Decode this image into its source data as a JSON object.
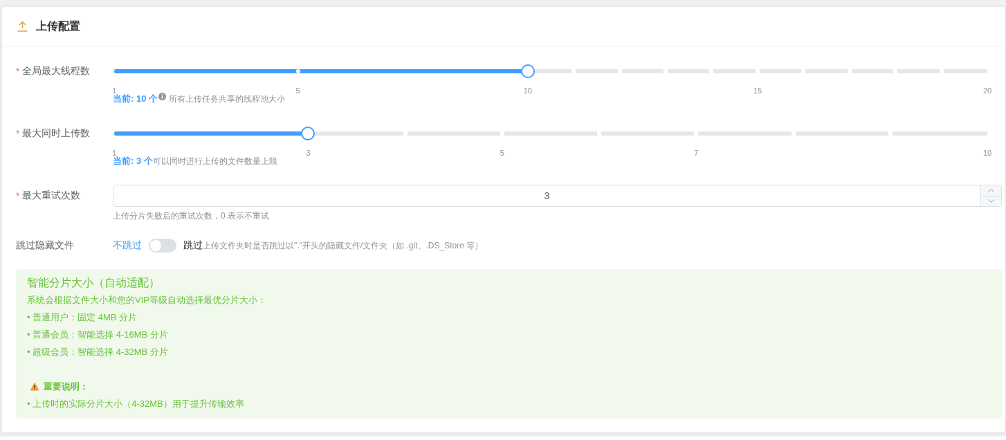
{
  "card": {
    "title": "上传配置"
  },
  "fields": [
    {
      "kind": "slider",
      "required_mark": "*",
      "label": "全局最大线程数",
      "level": 0.4737,
      "marks": [
        "1",
        "5",
        "10",
        "15",
        "20"
      ],
      "current": "当前: 10 个",
      "info_icon": true,
      "hint": "所有上传任务共享的线程池大小"
    },
    {
      "kind": "slider",
      "required_mark": "*",
      "label": "最大同时上传数",
      "level": 0.2222,
      "marks": [
        "1",
        "3",
        "5",
        "7",
        "10"
      ],
      "current": "当前: 3 个",
      "hint": "可以同时进行上传的文件数量上限"
    },
    {
      "kind": "number",
      "required_mark": "*",
      "label": "最大重试次数",
      "value": "3",
      "hint": "上传分片失败后的重试次数，0 表示不重试"
    },
    {
      "kind": "switch",
      "label": "跳过隐藏文件",
      "off_label": "不跳过",
      "on_label": "跳过",
      "on": false,
      "hint": "上传文件夹时是否跳过以\".\"开头的隐藏文件/文件夹（如 .git、.DS_Store 等）"
    }
  ],
  "tip": {
    "title": "智能分片大小（自动适配）",
    "description": "系统会根据文件大小和您的VIP等级自动选择最优分片大小：",
    "items": [
      "• 普通用户：固定 4MB 分片",
      "• 普通会员：智能选择 4-16MB 分片",
      "• 超级会员：智能选择 4-32MB 分片"
    ],
    "notice": {
      "title": "重要说明：",
      "items": [
        "• 上传时的实际分片大小（4-32MB）用于提升传输效率"
      ]
    }
  }
}
